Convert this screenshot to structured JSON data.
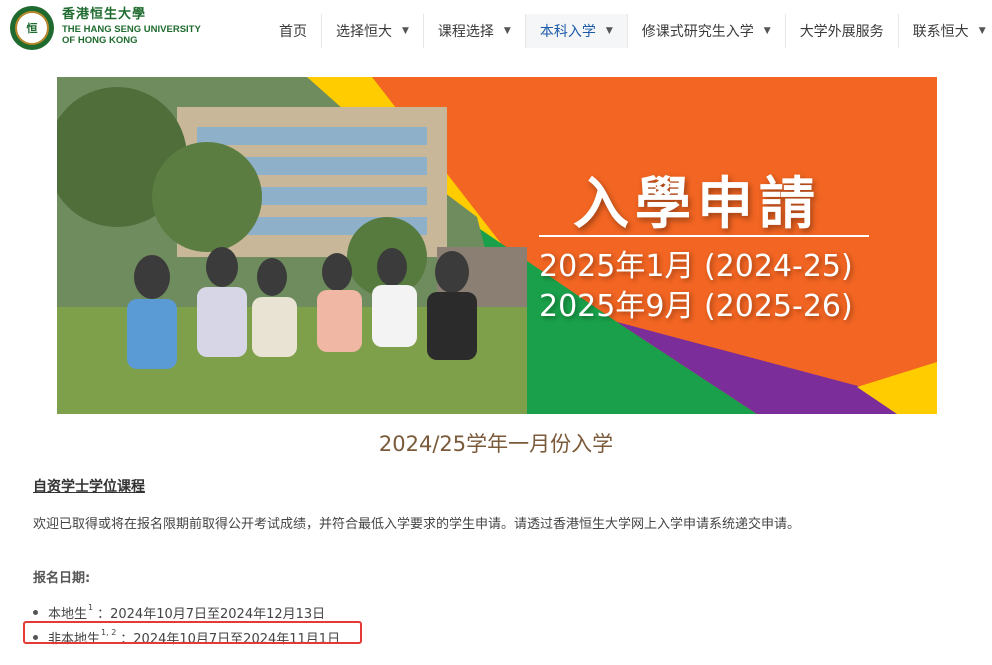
{
  "brand": {
    "name_cn": "香港恒生大學",
    "name_en_line1": "THE HANG SENG UNIVERSITY",
    "name_en_line2": "OF HONG KONG",
    "logo_text": "恒"
  },
  "nav": [
    {
      "label": "首页",
      "dropdown": false,
      "active": false
    },
    {
      "label": "选择恒大",
      "dropdown": true,
      "active": false
    },
    {
      "label": "课程选择",
      "dropdown": true,
      "active": false
    },
    {
      "label": "本科入学",
      "dropdown": true,
      "active": true
    },
    {
      "label": "修课式研究生入学",
      "dropdown": true,
      "active": false
    },
    {
      "label": "大学外展服务",
      "dropdown": false,
      "active": false
    },
    {
      "label": "联系恒大",
      "dropdown": true,
      "active": false
    }
  ],
  "nav_caret": "▼",
  "banner": {
    "title": "入學申請",
    "line1": "2025年1月 (2024-25)",
    "line2": "2025年9月 (2025-26)",
    "colors": {
      "orange": "#f26522",
      "purple": "#7b2d9a",
      "yellow": "#ffcc00",
      "green": "#1aa04a",
      "photo": "#5a7a55"
    }
  },
  "content": {
    "heading": "2024/25学年一月份入学",
    "subheading": "自资学士学位课程",
    "paragraph": "欢迎已取得或将在报名限期前取得公开考试成绩，并符合最低入学要求的学生申请。请透过香港恒生大学网上入学申请系统递交申请。",
    "dates_label": "报名日期:",
    "dates": [
      {
        "who": "本地生",
        "note": "1",
        "range": "：2024年10月7日至2024年12月13日"
      },
      {
        "who": "非本地生",
        "note": "1, 2",
        "range": "：2024年10月7日至2024年11月1日"
      }
    ]
  }
}
